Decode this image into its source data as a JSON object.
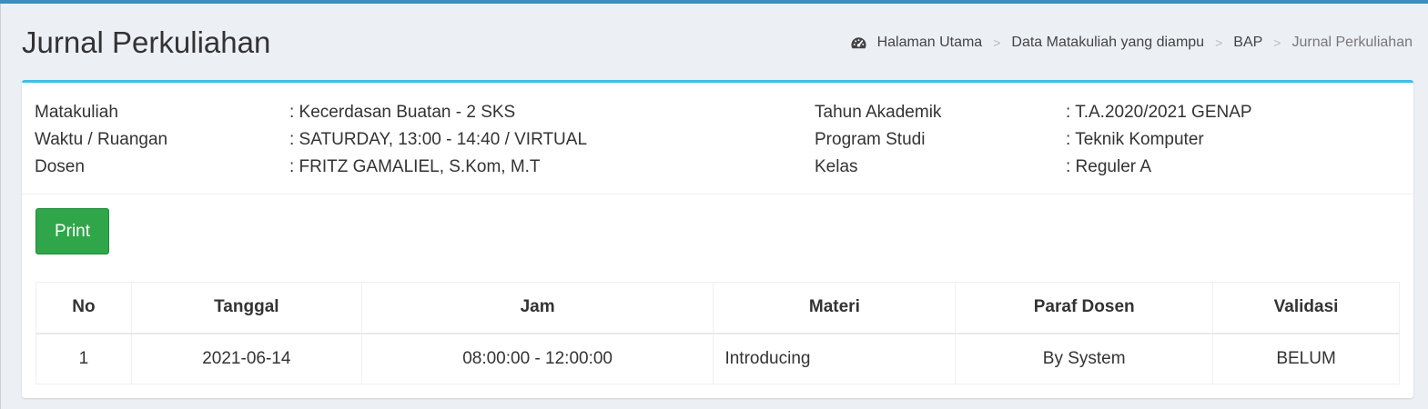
{
  "colors": {
    "accent_top": "#3c8dbc",
    "box_border": "#3ebde9",
    "print_button": "#30a64a",
    "background": "#ecf0f5"
  },
  "header": {
    "title": "Jurnal Perkuliahan",
    "breadcrumb": {
      "icon": "dashboard-icon",
      "items": [
        "Halaman Utama",
        "Data Matakuliah yang diampu",
        "BAP",
        "Jurnal Perkuliahan"
      ],
      "separator": ">"
    }
  },
  "info": {
    "matakuliah": {
      "label": "Matakuliah",
      "value": ": Kecerdasan Buatan - 2 SKS"
    },
    "waktu": {
      "label": "Waktu / Ruangan",
      "value": ": SATURDAY, 13:00 - 14:40 / VIRTUAL"
    },
    "dosen": {
      "label": "Dosen",
      "value": ": FRITZ GAMALIEL, S.Kom, M.T"
    },
    "tahun": {
      "label": "Tahun Akademik",
      "value": ": T.A.2020/2021 GENAP"
    },
    "prodi": {
      "label": "Program Studi",
      "value": ": Teknik Komputer"
    },
    "kelas": {
      "label": "Kelas",
      "value": ": Reguler A"
    }
  },
  "actions": {
    "print_label": "Print"
  },
  "table": {
    "headers": [
      "No",
      "Tanggal",
      "Jam",
      "Materi",
      "Paraf Dosen",
      "Validasi"
    ],
    "rows": [
      [
        "1",
        "2021-06-14",
        "08:00:00 - 12:00:00",
        "Introducing",
        "By System",
        "BELUM"
      ]
    ]
  }
}
